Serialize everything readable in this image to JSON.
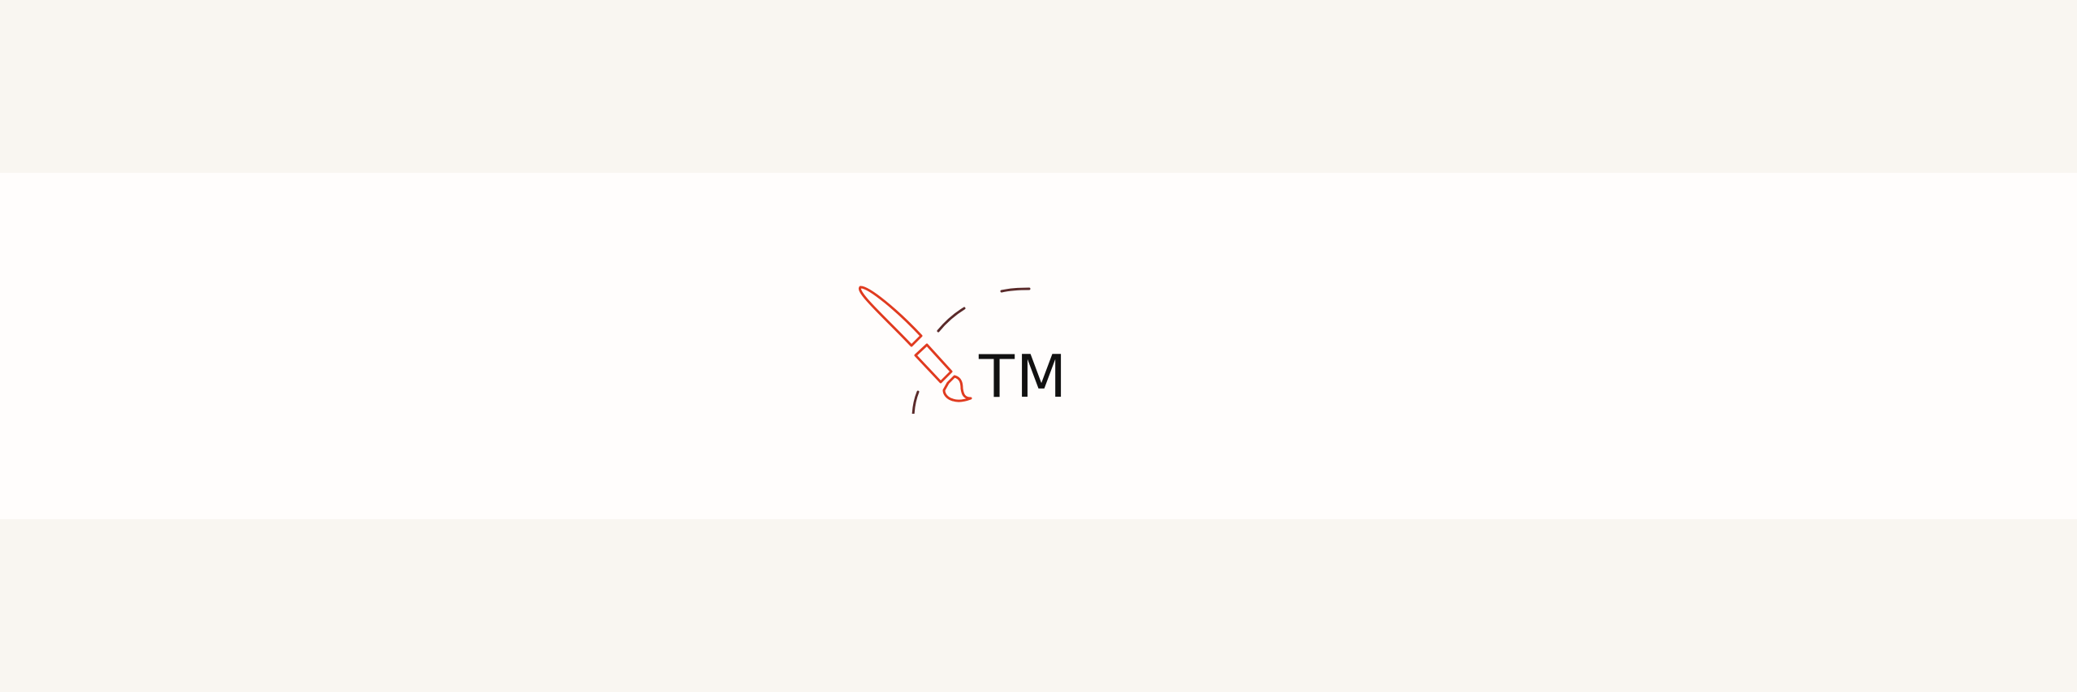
{
  "logo": {
    "text": "TM",
    "icon_name": "paintbrush-icon",
    "colors": {
      "brush": "#e03a1f",
      "arc": "#5a2a2a",
      "text": "#111111",
      "band_light": "#f9f6f1",
      "band_center": "#fffdfc"
    }
  }
}
